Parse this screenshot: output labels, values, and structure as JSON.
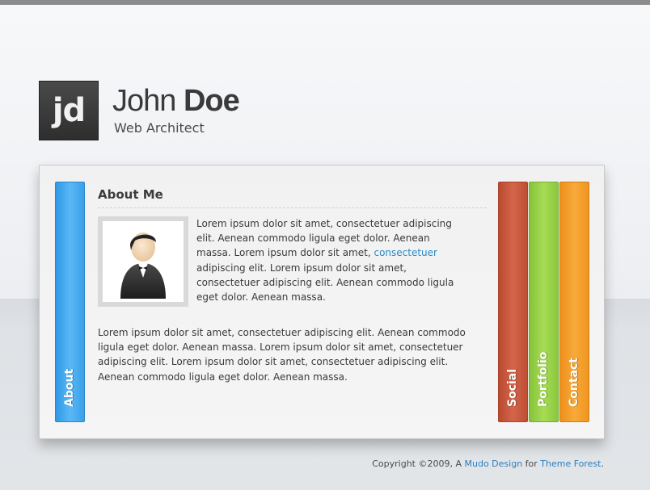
{
  "header": {
    "logo_text": "jd",
    "first_name": "John",
    "last_name": "Doe",
    "subtitle": "Web Architect"
  },
  "tabs": [
    {
      "label": "About",
      "color": "#3aa0ea"
    },
    {
      "label": "Social",
      "color": "#c3533a"
    },
    {
      "label": "Portfolio",
      "color": "#93cf45"
    },
    {
      "label": "Contact",
      "color": "#f29a25"
    }
  ],
  "about": {
    "title": "About Me",
    "avatar": "user-avatar-icon",
    "p1_before": "Lorem ipsum dolor sit amet, consectetuer adipiscing elit. Aenean commodo ligula eget dolor. Aenean massa. Lorem ipsum dolor sit amet, ",
    "p1_link": "consectetuer",
    "p1_after": " adipiscing elit. Lorem ipsum dolor sit amet, consectetuer adipiscing elit. Aenean commodo ligula eget dolor. Aenean massa.",
    "p2": "Lorem ipsum dolor sit amet, consectetuer adipiscing elit. Aenean commodo ligula eget dolor. Aenean massa. Lorem ipsum dolor sit amet, consectetuer adipiscing elit. Lorem ipsum dolor sit amet, consectetuer adipiscing elit. Aenean commodo ligula eget dolor. Aenean massa."
  },
  "footer": {
    "prefix": "Copyright ©2009, A ",
    "link1": "Mudo Design",
    "middle": " for ",
    "link2": "Theme Forest",
    "suffix": "."
  }
}
